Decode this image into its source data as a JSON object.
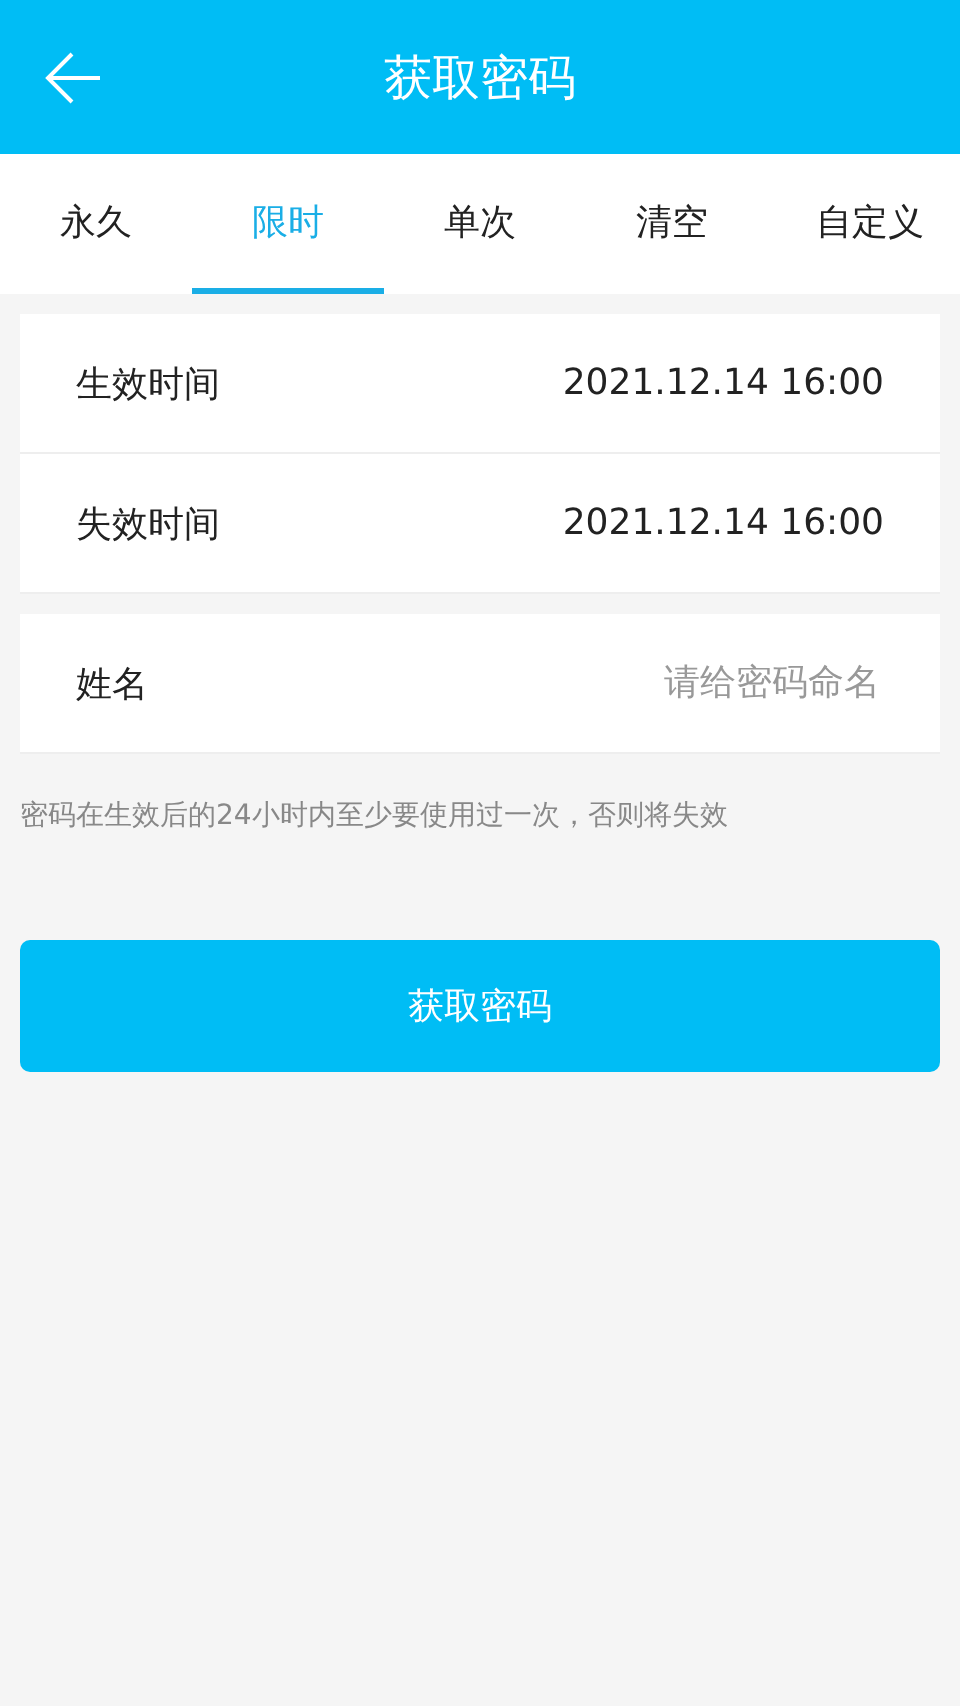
{
  "header": {
    "title": "获取密码"
  },
  "tabs": [
    {
      "label": "永久",
      "selected": false
    },
    {
      "label": "限时",
      "selected": true
    },
    {
      "label": "单次",
      "selected": false
    },
    {
      "label": "清空",
      "selected": false
    },
    {
      "label": "自定义",
      "selected": false
    }
  ],
  "time_rows": [
    {
      "label": "生效时间",
      "value": "2021.12.14 16:00"
    },
    {
      "label": "失效时间",
      "value": "2021.12.14 16:00"
    }
  ],
  "name_field": {
    "label": "姓名",
    "placeholder": "请给密码命名"
  },
  "hint": "密码在生效后的24小时内至少要使用过一次，否则将失效",
  "submit_button": "获取密码"
}
